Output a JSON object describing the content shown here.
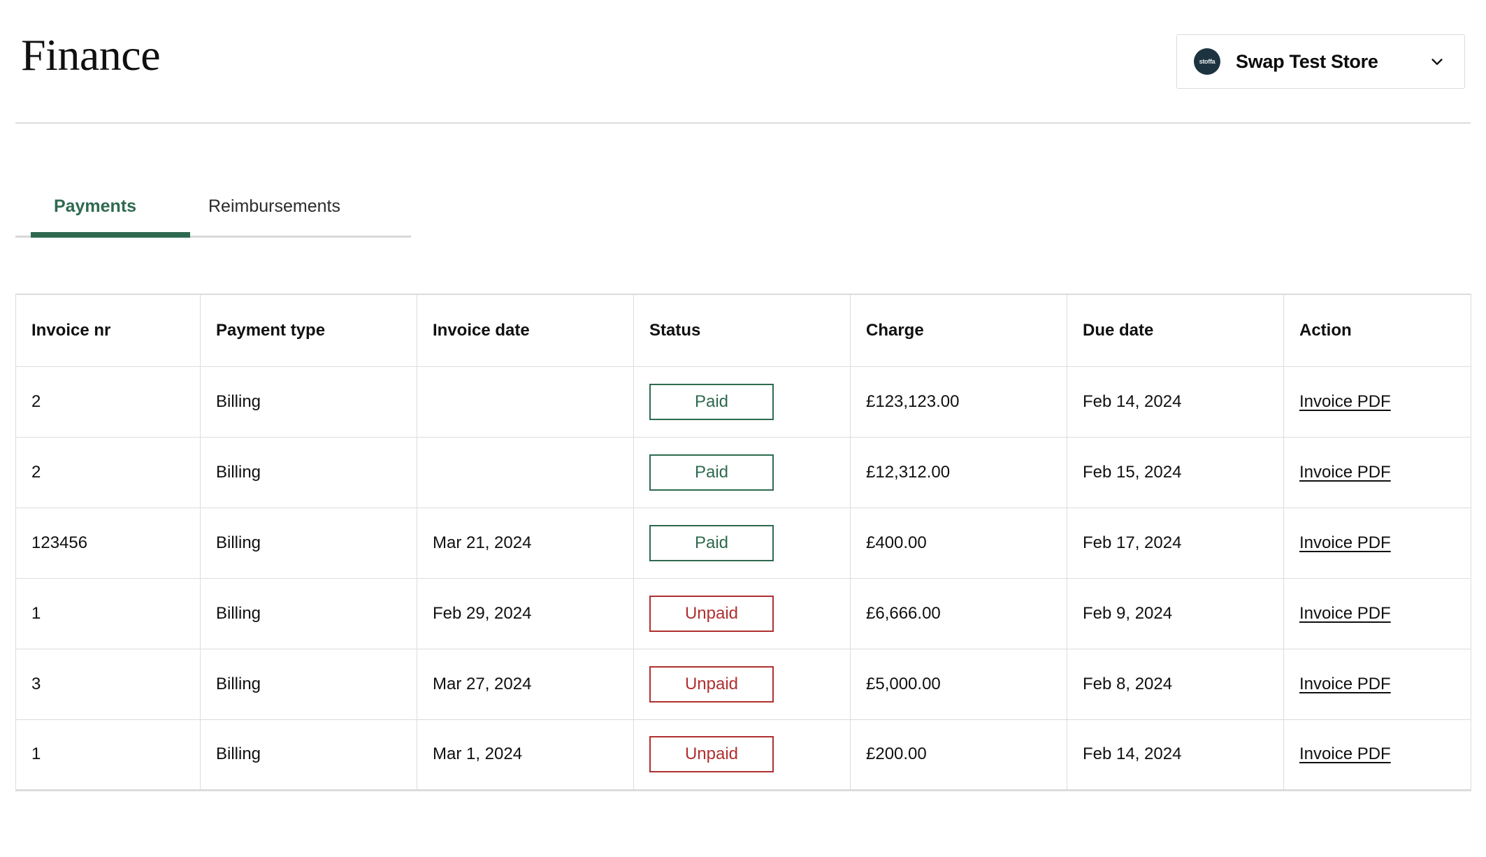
{
  "header": {
    "title": "Finance",
    "store_selector": {
      "logo_text": "stoffa",
      "store_name": "Swap Test Store",
      "chevron_icon": "chevron-down-icon"
    }
  },
  "tabs": [
    {
      "label": "Payments",
      "active": true
    },
    {
      "label": "Reimbursements",
      "active": false
    }
  ],
  "table": {
    "columns": [
      "Invoice nr",
      "Payment type",
      "Invoice date",
      "Status",
      "Charge",
      "Due date",
      "Action"
    ],
    "rows": [
      {
        "invoice_nr": "2",
        "payment_type": "Billing",
        "invoice_date": "",
        "status": "Paid",
        "status_kind": "paid",
        "charge": "£123,123.00",
        "due_date": "Feb 14, 2024",
        "action": "Invoice PDF"
      },
      {
        "invoice_nr": "2",
        "payment_type": "Billing",
        "invoice_date": "",
        "status": "Paid",
        "status_kind": "paid",
        "charge": "£12,312.00",
        "due_date": "Feb 15, 2024",
        "action": "Invoice PDF"
      },
      {
        "invoice_nr": "123456",
        "payment_type": "Billing",
        "invoice_date": "Mar 21, 2024",
        "status": "Paid",
        "status_kind": "paid",
        "charge": "£400.00",
        "due_date": "Feb 17, 2024",
        "action": "Invoice PDF"
      },
      {
        "invoice_nr": "1",
        "payment_type": "Billing",
        "invoice_date": "Feb 29, 2024",
        "status": "Unpaid",
        "status_kind": "unpaid",
        "charge": "£6,666.00",
        "due_date": "Feb 9, 2024",
        "action": "Invoice PDF"
      },
      {
        "invoice_nr": "3",
        "payment_type": "Billing",
        "invoice_date": "Mar 27, 2024",
        "status": "Unpaid",
        "status_kind": "unpaid",
        "charge": "£5,000.00",
        "due_date": "Feb 8, 2024",
        "action": "Invoice PDF"
      },
      {
        "invoice_nr": "1",
        "payment_type": "Billing",
        "invoice_date": "Mar 1, 2024",
        "status": "Unpaid",
        "status_kind": "unpaid",
        "charge": "£200.00",
        "due_date": "Feb 14, 2024",
        "action": "Invoice PDF"
      }
    ]
  },
  "colors": {
    "accent_green": "#2e6a4f",
    "status_unpaid_red": "#b03030",
    "logo_navy": "#1d3440",
    "border_gray": "#dddddd"
  }
}
